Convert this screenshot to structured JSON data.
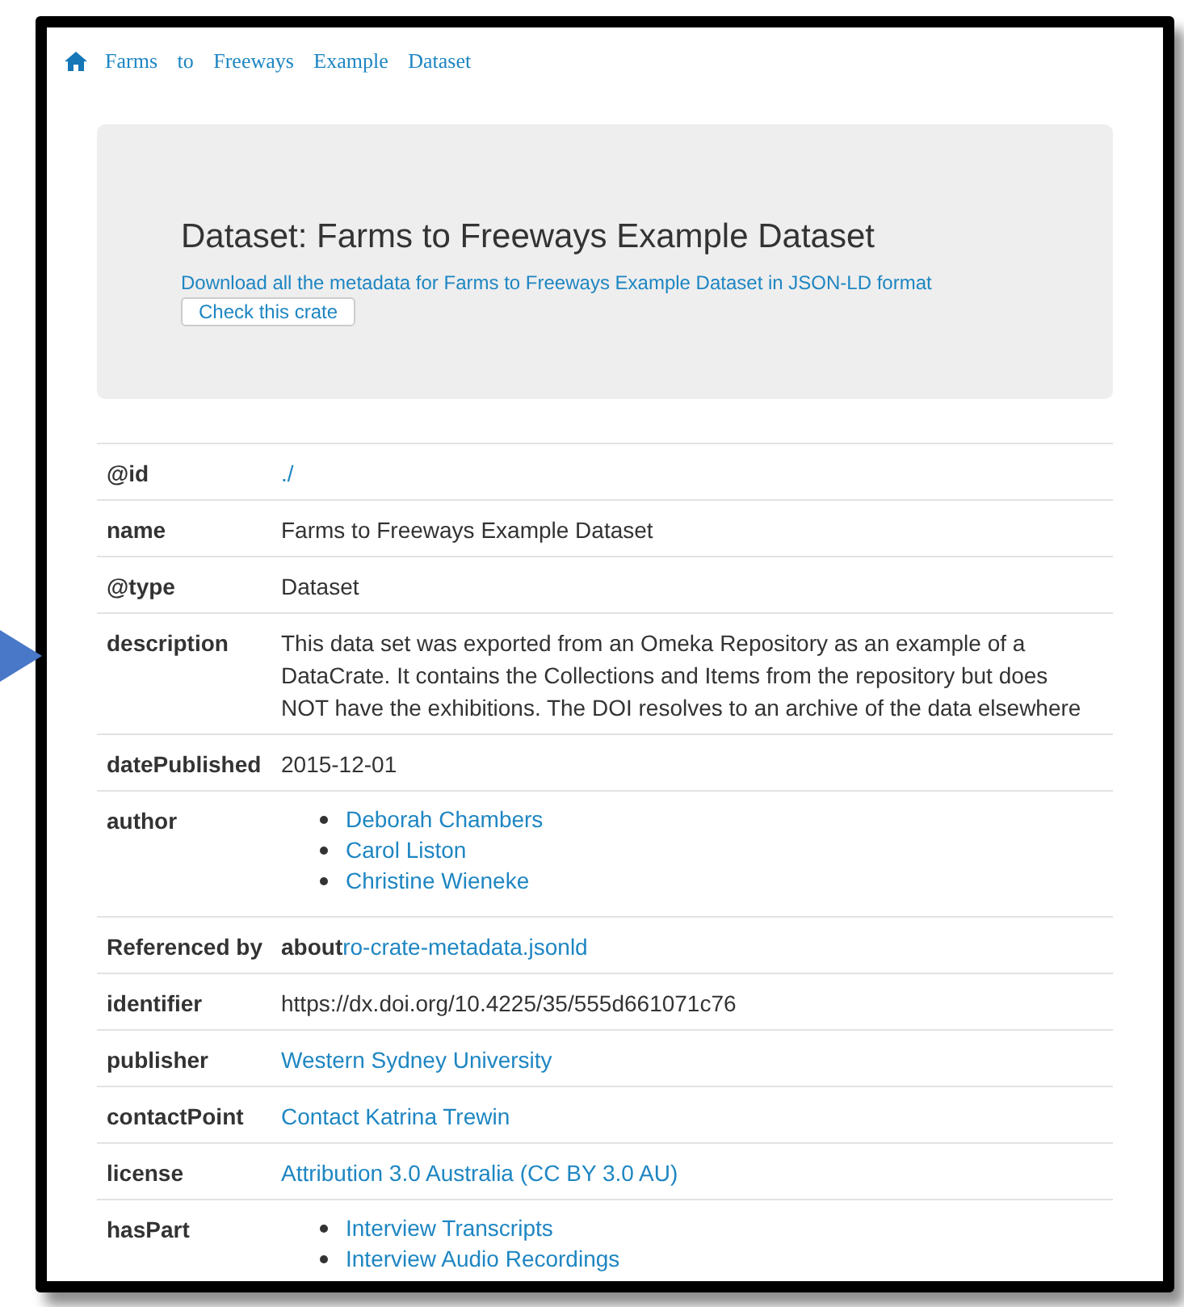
{
  "breadcrumb": {
    "label": "Farms to Freeways Example Dataset"
  },
  "header": {
    "title": "Dataset: Farms to Freeways Example Dataset",
    "download_link": "Download all the metadata for Farms to Freeways Example Dataset in JSON-LD format",
    "check_button": "Check this crate"
  },
  "properties": [
    {
      "key": "@id",
      "kind": "link",
      "value": "./"
    },
    {
      "key": "name",
      "kind": "text",
      "value": "Farms to Freeways Example Dataset"
    },
    {
      "key": "@type",
      "kind": "text",
      "value": "Dataset"
    },
    {
      "key": "description",
      "kind": "text",
      "value": "This data set was exported from an Omeka Repository as an example of a DataCrate. It contains the Collections and Items from the repository but does NOT have the exhibitions. The DOI resolves to an archive of the data elsewhere"
    },
    {
      "key": "datePublished",
      "kind": "text",
      "value": "2015-12-01"
    },
    {
      "key": "author",
      "kind": "list",
      "items": [
        "Deborah Chambers",
        "Carol Liston",
        "Christine Wieneke"
      ]
    },
    {
      "key": "Referenced by",
      "kind": "reference",
      "prefix": "about",
      "value": "ro-crate-metadata.jsonld"
    },
    {
      "key": "identifier",
      "kind": "text",
      "value": "https://dx.doi.org/10.4225/35/555d661071c76"
    },
    {
      "key": "publisher",
      "kind": "link",
      "value": "Western Sydney University"
    },
    {
      "key": "contactPoint",
      "kind": "link",
      "value": "Contact Katrina Trewin"
    },
    {
      "key": "license",
      "kind": "link",
      "value": "Attribution 3.0 Australia (CC BY 3.0 AU)"
    },
    {
      "key": "hasPart",
      "kind": "list",
      "items": [
        "Interview Transcripts",
        "Interview Audio Recordings"
      ]
    }
  ]
}
